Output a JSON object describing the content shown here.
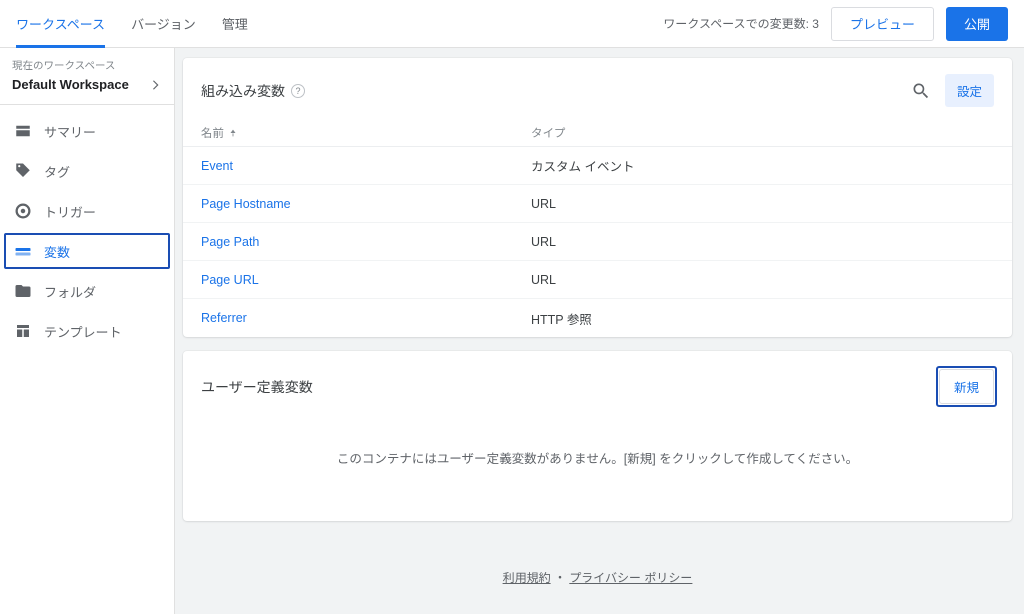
{
  "top": {
    "tabs": [
      "ワークスペース",
      "バージョン",
      "管理"
    ],
    "changes_label": "ワークスペースでの変更数: 3",
    "preview": "プレビュー",
    "publish": "公開"
  },
  "workspace": {
    "caption": "現在のワークスペース",
    "name": "Default Workspace"
  },
  "sidebar": {
    "items": [
      {
        "label": "サマリー",
        "icon": "dashboard"
      },
      {
        "label": "タグ",
        "icon": "tag"
      },
      {
        "label": "トリガー",
        "icon": "target"
      },
      {
        "label": "変数",
        "icon": "variable",
        "active": true,
        "highlight": true
      },
      {
        "label": "フォルダ",
        "icon": "folder"
      },
      {
        "label": "テンプレート",
        "icon": "template"
      }
    ]
  },
  "builtin": {
    "title": "組み込み変数",
    "config_label": "設定",
    "columns": {
      "name": "名前",
      "type": "タイプ"
    },
    "rows": [
      {
        "name": "Event",
        "type": "カスタム イベント"
      },
      {
        "name": "Page Hostname",
        "type": "URL"
      },
      {
        "name": "Page Path",
        "type": "URL"
      },
      {
        "name": "Page URL",
        "type": "URL"
      },
      {
        "name": "Referrer",
        "type": "HTTP 参照"
      }
    ]
  },
  "user": {
    "title": "ユーザー定義変数",
    "new_label": "新規",
    "empty": "このコンテナにはユーザー定義変数がありません。[新規] をクリックして作成してください。"
  },
  "footer": {
    "terms": "利用規約",
    "privacy": "プライバシー ポリシー"
  }
}
